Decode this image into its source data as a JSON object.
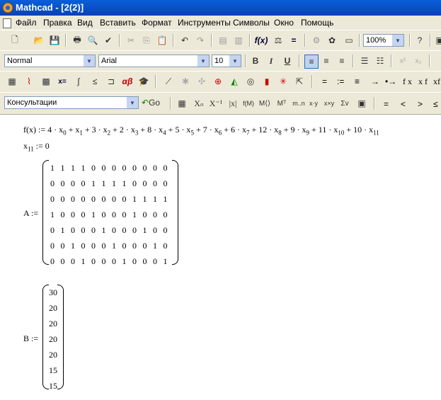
{
  "window": {
    "title": "Mathcad - [2(2)]"
  },
  "menu": [
    "Файл",
    "Правка",
    "Вид",
    "Вставить",
    "Формат",
    "Инструменты",
    "Символы",
    "Окно",
    "Помощь"
  ],
  "toolbar_standard": {
    "zoom": "100%"
  },
  "toolbar_format": {
    "style": "Normal",
    "font": "Arial",
    "size": "10",
    "bold": "B",
    "italic": "I",
    "underline": "U"
  },
  "toolbar_math_symbols": [
    "=",
    ":=",
    "≡",
    "→",
    "•→",
    "f x",
    "x f",
    "xf"
  ],
  "toolbar_resources": {
    "combo": "Консультации",
    "go_label": "Go"
  },
  "toolbar_calc_symbols": [
    "=",
    "<",
    ">",
    "≤"
  ],
  "document": {
    "f_def_lhs": "f(x) :=",
    "x11_def": "x",
    "x11_sub": "11",
    "x11_rhs": ":= 0",
    "A_label": "A :=",
    "A_matrix": [
      [
        "1",
        "1",
        "1",
        "1",
        "0",
        "0",
        "0",
        "0",
        "0",
        "0",
        "0",
        "0"
      ],
      [
        "0",
        "0",
        "0",
        "0",
        "1",
        "1",
        "1",
        "1",
        "0",
        "0",
        "0",
        "0"
      ],
      [
        "0",
        "0",
        "0",
        "0",
        "0",
        "0",
        "0",
        "0",
        "1",
        "1",
        "1",
        "1"
      ],
      [
        "1",
        "0",
        "0",
        "0",
        "1",
        "0",
        "0",
        "0",
        "1",
        "0",
        "0",
        "0"
      ],
      [
        "0",
        "1",
        "0",
        "0",
        "0",
        "1",
        "0",
        "0",
        "0",
        "1",
        "0",
        "0"
      ],
      [
        "0",
        "0",
        "1",
        "0",
        "0",
        "0",
        "1",
        "0",
        "0",
        "0",
        "1",
        "0"
      ],
      [
        "0",
        "0",
        "0",
        "1",
        "0",
        "0",
        "0",
        "1",
        "0",
        "0",
        "0",
        "1"
      ]
    ],
    "B_label": "B :=",
    "B_vector": [
      "30",
      "20",
      "20",
      "20",
      "20",
      "15",
      "15"
    ]
  }
}
